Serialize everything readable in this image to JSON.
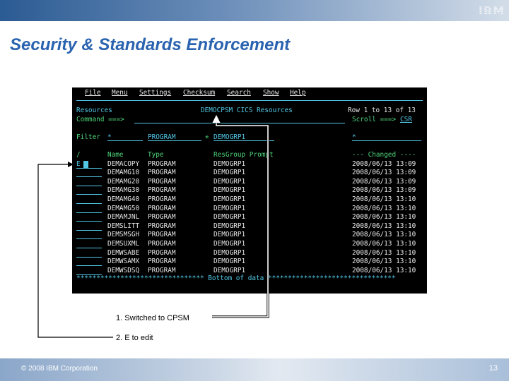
{
  "header": {
    "logo_text": "IBM"
  },
  "slide": {
    "title": "Security & Standards Enforcement"
  },
  "terminal": {
    "menu": [
      "File",
      "Menu",
      "Settings",
      "Checksum",
      "Search",
      "Show",
      "Help"
    ],
    "panel_name": "Resources",
    "panel_title": "DEMOCPSM CICS Resources",
    "row_info": "Row 1 to 13 of 13",
    "command_label": "Command ===>",
    "scroll_label": "Scroll ===>",
    "scroll_value": "CSR",
    "filter_label": "Filter",
    "filter_name": "*",
    "filter_type": "PROGRAM",
    "filter_plus": "+",
    "filter_resgroup": "DEMOGRP1",
    "filter_changed": "*",
    "columns": {
      "slash": "/",
      "name": "Name",
      "type": "Type",
      "resgroup": "ResGroup Prompt",
      "changed": "--- Changed ----"
    },
    "rows": [
      {
        "cmd": "E",
        "name": "DEMACOPY",
        "type": "PROGRAM",
        "resgroup": "DEMOGRP1",
        "changed": "2008/06/13 13:09"
      },
      {
        "cmd": "",
        "name": "DEMAMG10",
        "type": "PROGRAM",
        "resgroup": "DEMOGRP1",
        "changed": "2008/06/13 13:09"
      },
      {
        "cmd": "",
        "name": "DEMAMG20",
        "type": "PROGRAM",
        "resgroup": "DEMOGRP1",
        "changed": "2008/06/13 13:09"
      },
      {
        "cmd": "",
        "name": "DEMAMG30",
        "type": "PROGRAM",
        "resgroup": "DEMOGRP1",
        "changed": "2008/06/13 13:09"
      },
      {
        "cmd": "",
        "name": "DEMAMG40",
        "type": "PROGRAM",
        "resgroup": "DEMOGRP1",
        "changed": "2008/06/13 13:10"
      },
      {
        "cmd": "",
        "name": "DEMAMG50",
        "type": "PROGRAM",
        "resgroup": "DEMOGRP1",
        "changed": "2008/06/13 13:10"
      },
      {
        "cmd": "",
        "name": "DEMAMJNL",
        "type": "PROGRAM",
        "resgroup": "DEMOGRP1",
        "changed": "2008/06/13 13:10"
      },
      {
        "cmd": "",
        "name": "DEMSLITT",
        "type": "PROGRAM",
        "resgroup": "DEMOGRP1",
        "changed": "2008/06/13 13:10"
      },
      {
        "cmd": "",
        "name": "DEMSMSGH",
        "type": "PROGRAM",
        "resgroup": "DEMOGRP1",
        "changed": "2008/06/13 13:10"
      },
      {
        "cmd": "",
        "name": "DEMSUXML",
        "type": "PROGRAM",
        "resgroup": "DEMOGRP1",
        "changed": "2008/06/13 13:10"
      },
      {
        "cmd": "",
        "name": "DEMWSABE",
        "type": "PROGRAM",
        "resgroup": "DEMOGRP1",
        "changed": "2008/06/13 13:10"
      },
      {
        "cmd": "",
        "name": "DEMWSAMX",
        "type": "PROGRAM",
        "resgroup": "DEMOGRP1",
        "changed": "2008/06/13 13:10"
      },
      {
        "cmd": "",
        "name": "DEMWSDSQ",
        "type": "PROGRAM",
        "resgroup": "DEMOGRP1",
        "changed": "2008/06/13 13:10"
      }
    ],
    "bottom_marker": "******************************** Bottom of data ********************************"
  },
  "callouts": {
    "step1": "1. Switched to CPSM",
    "step2": "2. E to edit"
  },
  "footer": {
    "copyright": "© 2008 IBM Corporation",
    "page_number": "13"
  }
}
